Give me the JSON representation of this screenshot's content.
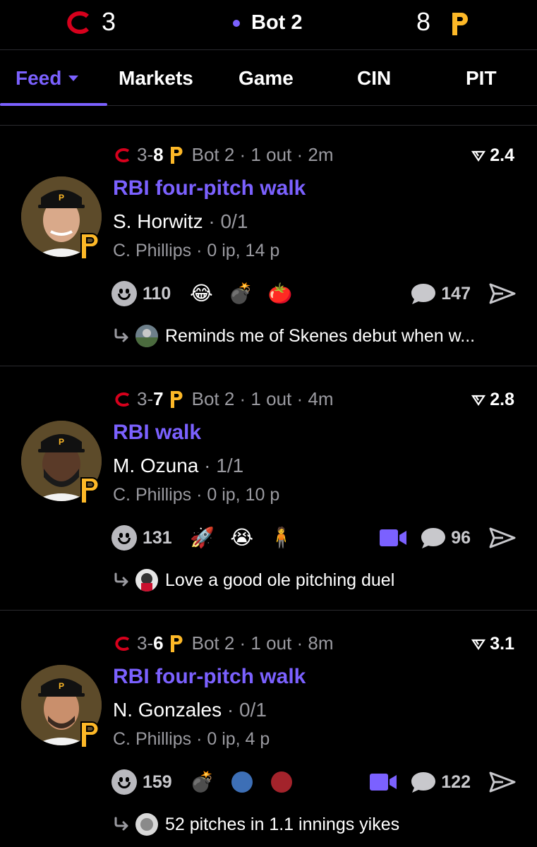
{
  "scoreboard": {
    "away_score": "3",
    "status": "Bot 2",
    "home_score": "8",
    "away_color": "#d6001c",
    "home_color": "#fdb827",
    "status_dot_color": "#7b61ff"
  },
  "tabs": [
    {
      "label": "Feed",
      "active": true
    },
    {
      "label": "Markets"
    },
    {
      "label": "Game"
    },
    {
      "label": "CIN"
    },
    {
      "label": "PIT"
    }
  ],
  "accent_color": "#7b61ff",
  "feed": [
    {
      "away_runs": "3",
      "home_runs": "8",
      "situation": "Bot 2 · 1 out · 2m",
      "odds": "2.4",
      "title": "RBI four-pitch walk",
      "batter_name": "S. Horwitz",
      "batter_stat": "0/1",
      "pitcher_line": "C. Phillips · 0 ip, 14 p",
      "reaction_count": "110",
      "emojis": [
        "laughing-crying",
        "bomb",
        "tomato"
      ],
      "has_video": false,
      "comment_count": "147",
      "reply_text": "Reminds me of Skenes debut when w..."
    },
    {
      "away_runs": "3",
      "home_runs": "7",
      "situation": "Bot 2 · 1 out · 4m",
      "odds": "2.8",
      "title": "RBI walk",
      "batter_name": "M. Ozuna",
      "batter_stat": "1/1",
      "pitcher_line": "C. Phillips · 0 ip, 10 p",
      "reaction_count": "131",
      "emojis": [
        "rocket",
        "crying",
        "person"
      ],
      "has_video": true,
      "comment_count": "96",
      "reply_text": "Love a good ole pitching duel"
    },
    {
      "away_runs": "3",
      "home_runs": "6",
      "situation": "Bot 2 · 1 out · 8m",
      "odds": "3.1",
      "title": "RBI four-pitch walk",
      "batter_name": "N. Gonzales",
      "batter_stat": "0/1",
      "pitcher_line": "C. Phillips · 0 ip, 4 p",
      "reaction_count": "159",
      "emojis": [
        "bomb",
        "blue-circle",
        "red-circle"
      ],
      "has_video": true,
      "comment_count": "122",
      "reply_text": "52 pitches in 1.1 innings yikes"
    }
  ]
}
